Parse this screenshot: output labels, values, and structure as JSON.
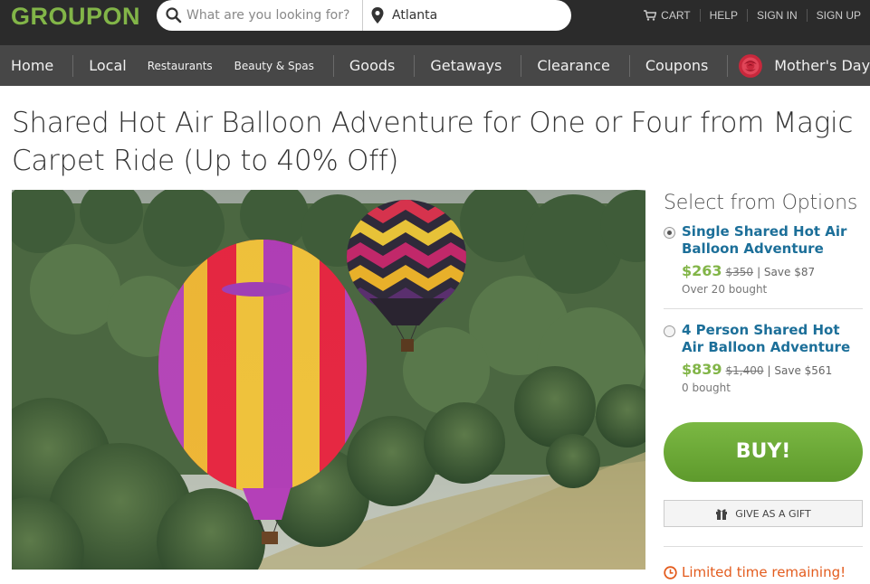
{
  "header": {
    "logo": "GROUPON",
    "search": {
      "placeholder": "What are you looking for?",
      "value": ""
    },
    "location": {
      "value": "Atlanta"
    },
    "links": {
      "cart": "CART",
      "help": "HELP",
      "sign_in": "SIGN IN",
      "sign_up": "SIGN UP"
    }
  },
  "nav": {
    "home": "Home",
    "local": "Local",
    "restaurants": "Restaurants",
    "beauty": "Beauty & Spas",
    "goods": "Goods",
    "getaways": "Getaways",
    "clearance": "Clearance",
    "coupons": "Coupons",
    "mothers_day": "Mother's Day"
  },
  "deal": {
    "title": "Shared Hot Air Balloon Adventure for One or Four from Magic Carpet Ride (Up to 40% Off)"
  },
  "options": {
    "heading": "Select from Options",
    "items": [
      {
        "name": "Single Shared Hot Air Balloon Adventure",
        "price": "$263",
        "original": "$350",
        "save": "| Save $87",
        "bought": "Over 20 bought",
        "selected": true
      },
      {
        "name": "4 Person Shared Hot Air Balloon Adventure",
        "price": "$839",
        "original": "$1,400",
        "save": "| Save $561",
        "bought": "0 bought",
        "selected": false
      }
    ]
  },
  "actions": {
    "buy": "BUY!",
    "gift": "GIVE AS A GIFT",
    "limited": "Limited time remaining!"
  },
  "icons": [
    "search-icon",
    "location-pin-icon",
    "cart-icon",
    "rose-icon",
    "gift-icon",
    "clock-icon"
  ],
  "colors": {
    "brand_green": "#82b548",
    "link_blue": "#1c6f99",
    "alert_orange": "#e35c1e",
    "topbar": "#2b2b2b",
    "navbar": "#474747"
  }
}
